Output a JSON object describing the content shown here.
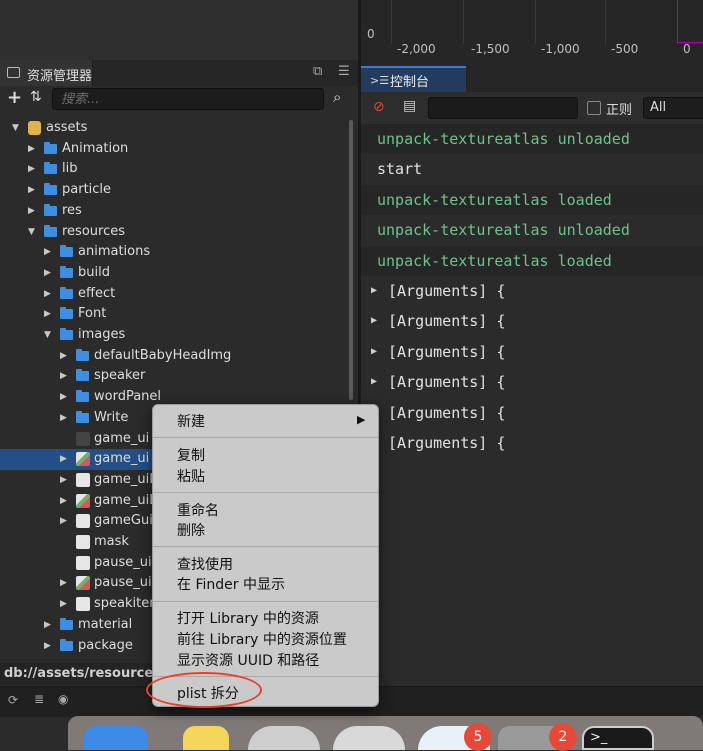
{
  "timeline": {
    "ruler_origin": "0",
    "ruler_labels": [
      "-2,000",
      "-1,500",
      "-1,000",
      "-500",
      "0"
    ]
  },
  "assets_panel": {
    "title": "资源管理器",
    "search_placeholder": "搜索...",
    "tree": [
      {
        "label": "assets",
        "depth": 0,
        "kind": "db",
        "expanded": true
      },
      {
        "label": "Animation",
        "depth": 1,
        "kind": "folder"
      },
      {
        "label": "lib",
        "depth": 1,
        "kind": "folder"
      },
      {
        "label": "particle",
        "depth": 1,
        "kind": "folder"
      },
      {
        "label": "res",
        "depth": 1,
        "kind": "folder"
      },
      {
        "label": "resources",
        "depth": 1,
        "kind": "folder",
        "expanded": true
      },
      {
        "label": "animations",
        "depth": 2,
        "kind": "folder"
      },
      {
        "label": "build",
        "depth": 2,
        "kind": "folder"
      },
      {
        "label": "effect",
        "depth": 2,
        "kind": "folder"
      },
      {
        "label": "Font",
        "depth": 2,
        "kind": "folder"
      },
      {
        "label": "images",
        "depth": 2,
        "kind": "folder",
        "expanded": true
      },
      {
        "label": "defaultBabyHeadImg",
        "depth": 3,
        "kind": "folder"
      },
      {
        "label": "speaker",
        "depth": 3,
        "kind": "folder"
      },
      {
        "label": "wordPanel",
        "depth": 3,
        "kind": "folder"
      },
      {
        "label": "Write",
        "depth": 3,
        "kind": "folder"
      },
      {
        "label": "game_ui",
        "depth": 3,
        "kind": "asset"
      },
      {
        "label": "game_ui",
        "depth": 3,
        "kind": "atlas",
        "selected": true
      },
      {
        "label": "game_uiLi",
        "depth": 3,
        "kind": "image"
      },
      {
        "label": "game_uiLi",
        "depth": 3,
        "kind": "atlas"
      },
      {
        "label": "gameGuid",
        "depth": 3,
        "kind": "image"
      },
      {
        "label": "mask",
        "depth": 3,
        "kind": "image"
      },
      {
        "label": "pause_ui",
        "depth": 3,
        "kind": "image"
      },
      {
        "label": "pause_ui",
        "depth": 3,
        "kind": "atlas"
      },
      {
        "label": "speakitem",
        "depth": 3,
        "kind": "image"
      },
      {
        "label": "material",
        "depth": 2,
        "kind": "folder"
      },
      {
        "label": "package",
        "depth": 2,
        "kind": "folder"
      }
    ],
    "status_path": "db://assets/resources/in"
  },
  "console": {
    "title": "控制台",
    "regex_label": "正则",
    "level_value": "All",
    "logs": [
      {
        "text": "unpack-textureatlas unloaded",
        "style": "green"
      },
      {
        "text": "start",
        "style": "plain"
      },
      {
        "text": "unpack-textureatlas loaded",
        "style": "green"
      },
      {
        "text": "unpack-textureatlas unloaded",
        "style": "green"
      },
      {
        "text": "unpack-textureatlas loaded",
        "style": "green"
      },
      {
        "text": "[Arguments] {",
        "style": "collapsible"
      },
      {
        "text": "[Arguments] {",
        "style": "collapsible"
      },
      {
        "text": "[Arguments] {",
        "style": "collapsible"
      },
      {
        "text": "[Arguments] {",
        "style": "collapsible"
      },
      {
        "text": "[Arguments] {",
        "style": "collapsible"
      },
      {
        "text": "[Arguments] {",
        "style": "collapsible"
      }
    ]
  },
  "context_menu": {
    "new": "新建",
    "copy": "复制",
    "paste": "粘贴",
    "rename": "重命名",
    "delete": "删除",
    "find_usage": "查找使用",
    "show_in_finder": "在 Finder 中显示",
    "open_in_library": "打开 Library 中的资源",
    "goto_library": "前往 Library 中的资源位置",
    "show_uuid": "显示资源 UUID 和路径",
    "plist_split": "plist 拆分"
  },
  "dock": {
    "badge_1": "5",
    "badge_2": "2"
  },
  "colors": {
    "selection": "#234f86",
    "log_green": "#6fc28c",
    "annotation_red": "#e8402b",
    "folder_blue": "#3f8ee0"
  }
}
